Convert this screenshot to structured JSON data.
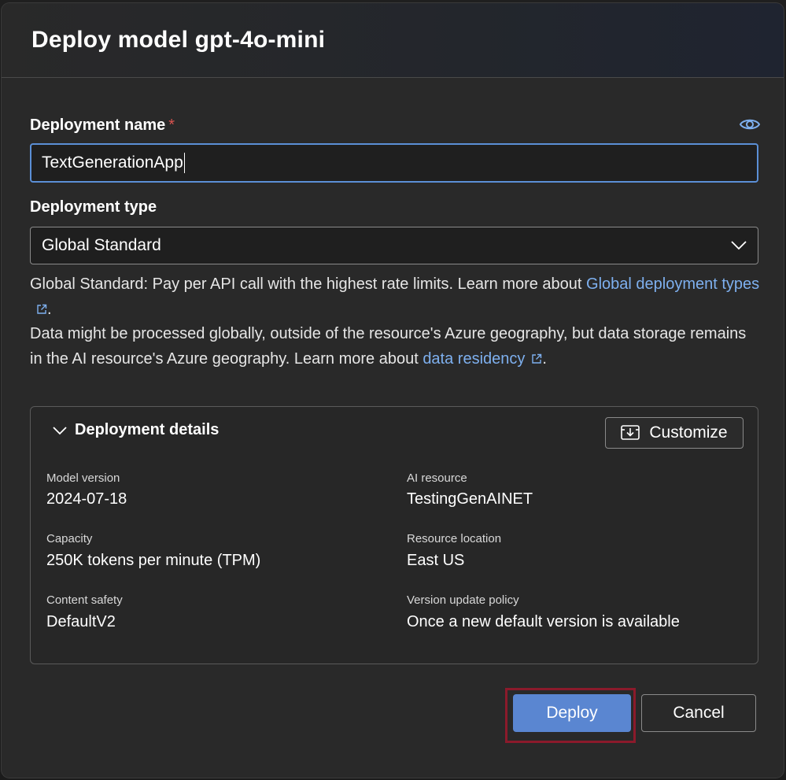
{
  "dialog": {
    "title": "Deploy model gpt-4o-mini"
  },
  "deployment_name": {
    "label": "Deployment name",
    "required_marker": "*",
    "value": "TextGenerationApp"
  },
  "deployment_type": {
    "label": "Deployment type",
    "selected": "Global Standard",
    "description_line1": "Global Standard: Pay per API call with the highest rate limits. Learn more about ",
    "description_link1": "Global deployment types",
    "description_line2": "Data might be processed globally, outside of the resource's Azure geography, but data storage remains in the AI resource's Azure geography. Learn more about ",
    "description_link2": "data residency",
    "period": "."
  },
  "details": {
    "toggle_label": "Deployment details",
    "customize_label": "Customize",
    "fields": [
      {
        "label": "Model version",
        "value": "2024-07-18"
      },
      {
        "label": "AI resource",
        "value": "TestingGenAINET"
      },
      {
        "label": "Capacity",
        "value": "250K tokens per minute (TPM)"
      },
      {
        "label": "Resource location",
        "value": "East US"
      },
      {
        "label": "Content safety",
        "value": "DefaultV2"
      },
      {
        "label": "Version update policy",
        "value": "Once a new default version is available"
      }
    ]
  },
  "footer": {
    "deploy_label": "Deploy",
    "cancel_label": "Cancel"
  },
  "colors": {
    "accent": "#5a86d1",
    "link": "#7eb0ef",
    "required": "#d9534f",
    "highlight_border": "#8b1a2b"
  },
  "icons": {
    "visibility": "eye-icon",
    "select_chevron": "chevron-down-icon",
    "external_link": "external-link-icon",
    "details_toggle": "chevron-down-icon",
    "customize": "download-box-icon"
  }
}
